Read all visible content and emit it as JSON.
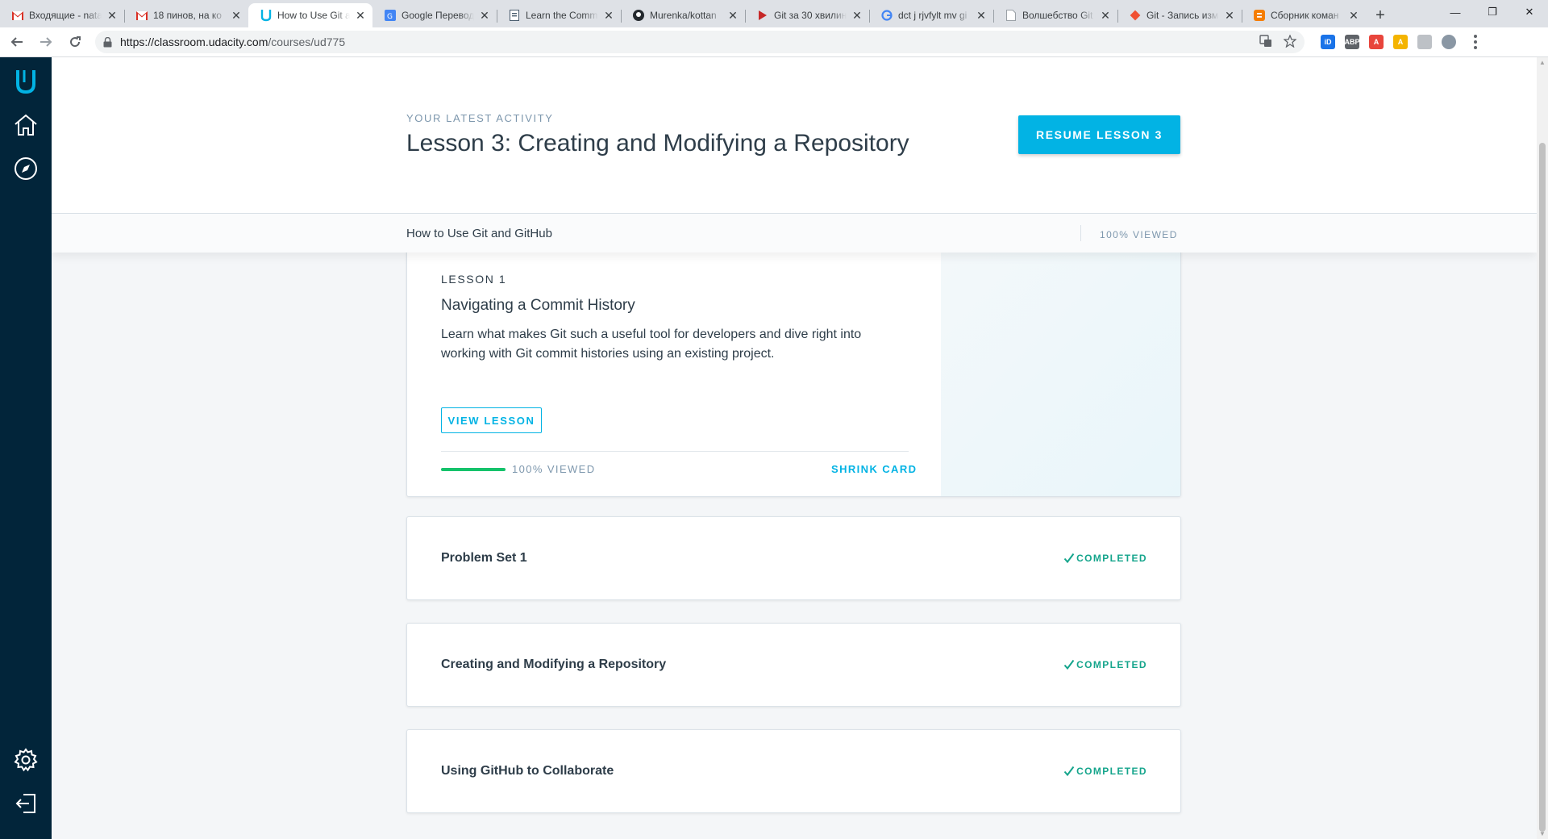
{
  "browser": {
    "tabs": [
      {
        "title": "Входящие - nata",
        "favicon": "gmail-icon",
        "color": "#d93025"
      },
      {
        "title": "18 пинов, на ко",
        "favicon": "gmail-icon",
        "color": "#d93025"
      },
      {
        "title": "How to Use Git a",
        "favicon": "udacity-icon",
        "color": "#02b3e4"
      },
      {
        "title": "Google Перевод",
        "favicon": "google-translate-icon",
        "color": "#4285f4"
      },
      {
        "title": "Learn the Comm",
        "favicon": "document-icon",
        "color": "#4a5d6e"
      },
      {
        "title": "Murenka/kottan",
        "favicon": "github-icon",
        "color": "#24292e"
      },
      {
        "title": "Git за 30 хвилин",
        "favicon": "play-icon",
        "color": "#c62828"
      },
      {
        "title": "dct j rjvfylt mv gi",
        "favicon": "google-icon",
        "color": "#4285f4"
      },
      {
        "title": "Волшебство Git",
        "favicon": "page-icon",
        "color": "#9aa0a6"
      },
      {
        "title": "Git - Запись изм",
        "favicon": "git-icon",
        "color": "#f05133"
      },
      {
        "title": "Сборник коман",
        "favicon": "blogger-icon",
        "color": "#f57d00"
      }
    ],
    "url_host": "https://classroom.udacity.com",
    "url_path": "/courses/ud775"
  },
  "sidebar": {
    "items": [
      "udacity-logo",
      "home-icon",
      "compass-icon",
      "settings-icon",
      "logout-icon"
    ]
  },
  "hero": {
    "eyebrow": "YOUR LATEST ACTIVITY",
    "title": "Lesson 3: Creating and Modifying a Repository",
    "resume_label": "RESUME LESSON 3"
  },
  "course_bar": {
    "name": "How to Use Git and GitHub",
    "viewed": "100% VIEWED"
  },
  "lesson_card": {
    "label": "LESSON 1",
    "title": "Navigating a Commit History",
    "description": "Learn what makes Git such a useful tool for developers and dive right into working with Git commit histories using an existing project.",
    "view_label": "VIEW LESSON",
    "progress": 1.0,
    "progress_text": "100% VIEWED",
    "shrink_label": "SHRINK CARD"
  },
  "items": [
    {
      "title": "Problem Set 1",
      "status": "COMPLETED"
    },
    {
      "title": "Creating and Modifying a Repository",
      "status": "COMPLETED"
    },
    {
      "title": "Using GitHub to Collaborate",
      "status": "COMPLETED"
    }
  ],
  "colors": {
    "sidebar": "#02253a",
    "accent": "#02b3e4",
    "progress": "#15c26b",
    "completed": "#15a58c"
  }
}
